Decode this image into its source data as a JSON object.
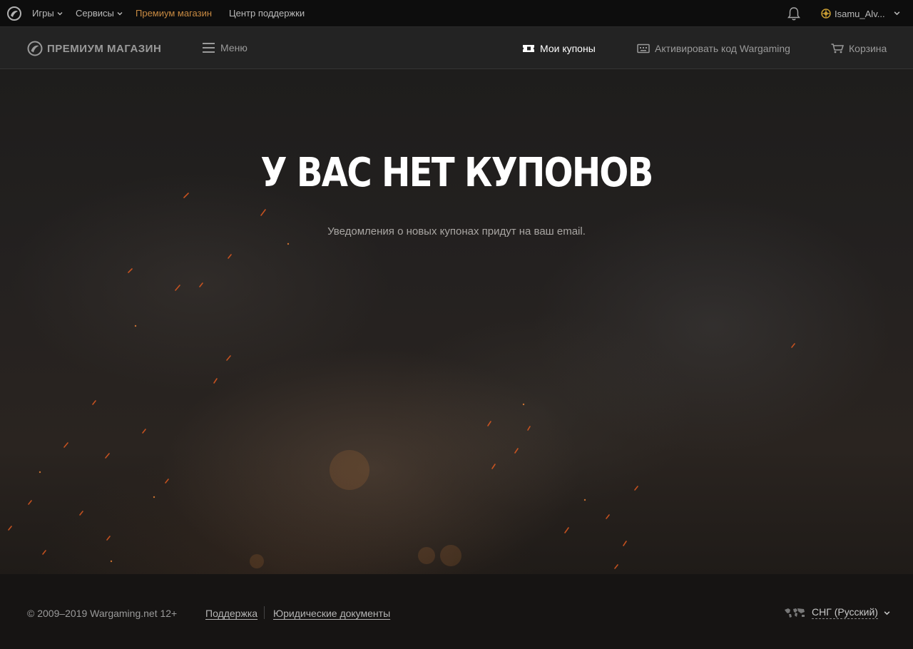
{
  "topbar": {
    "games_label": "Игры",
    "services_label": "Сервисы",
    "premium_shop_label": "Премиум магазин",
    "support_center_label": "Центр поддержки",
    "username": "Isamu_Alv..."
  },
  "shop_header": {
    "logo_text": "ПРЕМИУМ МАГАЗИН",
    "menu_label": "Меню",
    "my_coupons_label": "Мои купоны",
    "activate_code_label": "Активировать код Wargaming",
    "cart_label": "Корзина"
  },
  "hero": {
    "title": "У ВАС НЕТ КУПОНОВ",
    "subtitle": "Уведомления о новых купонах придут на ваш email."
  },
  "footer": {
    "copyright": "© 2009–2019 Wargaming.net 12+",
    "support_link": "Поддержка",
    "legal_link": "Юридические документы",
    "region_label": "СНГ (Русский)"
  },
  "colors": {
    "accent_orange": "#c88a42",
    "active_white": "#ffffff",
    "muted_gray": "#9a9a9a"
  }
}
